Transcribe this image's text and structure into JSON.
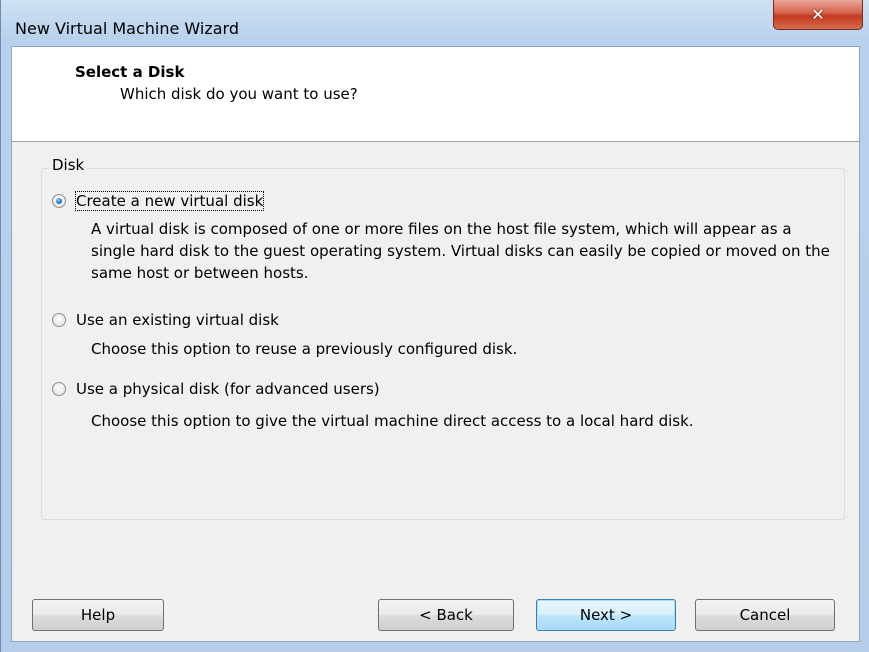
{
  "window": {
    "title": "New Virtual Machine Wizard",
    "close_glyph": "✕"
  },
  "header": {
    "title": "Select a Disk",
    "subtitle": "Which disk do you want to use?"
  },
  "disk_group": {
    "legend": "Disk",
    "options": [
      {
        "label": "Create a new virtual disk",
        "checked": true,
        "description": "A virtual disk is composed of one or more files on the host file system, which will appear as a single hard disk to the guest operating system. Virtual disks can easily be copied or moved on the same host or between hosts."
      },
      {
        "label": "Use an existing virtual disk",
        "checked": false,
        "description": "Choose this option to reuse a previously configured disk."
      },
      {
        "label": "Use a physical disk (for advanced users)",
        "checked": false,
        "description": "Choose this option to give the virtual machine direct access to a local hard disk."
      }
    ]
  },
  "buttons": {
    "help": "Help",
    "back": "< Back",
    "next": "Next >",
    "cancel": "Cancel"
  },
  "colors": {
    "title_bar": "#b8d1ec",
    "close_button": "#c23a22",
    "default_button_border": "#3c7fb1"
  }
}
